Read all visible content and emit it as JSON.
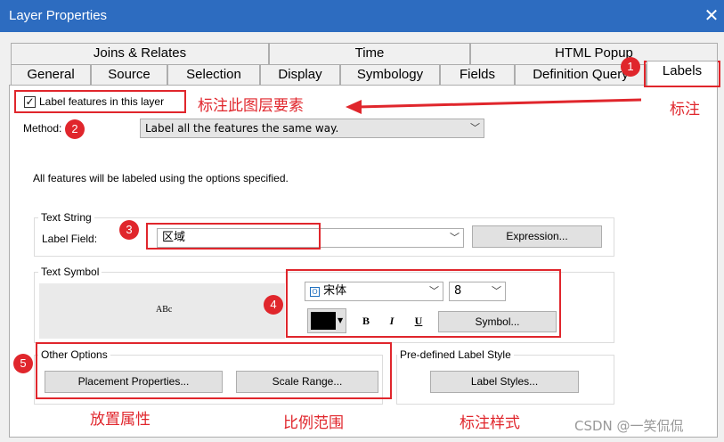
{
  "window": {
    "title": "Layer Properties"
  },
  "tabs_row1": [
    "Joins & Relates",
    "Time",
    "HTML Popup"
  ],
  "tabs_row2": [
    "General",
    "Source",
    "Selection",
    "Display",
    "Symbology",
    "Fields",
    "Definition Query",
    "Labels"
  ],
  "label_checkbox": {
    "label": "Label features in this layer",
    "checked": "✓"
  },
  "method": {
    "label": "Method:",
    "value": "Label all the features the same way."
  },
  "info_text": "All features will be labeled using the options specified.",
  "text_string": {
    "title": "Text String",
    "field_label": "Label Field:",
    "field_value": "区域",
    "expression_button": "Expression..."
  },
  "text_symbol": {
    "title": "Text Symbol",
    "preview": "ABc",
    "font": "宋体",
    "size": "8",
    "bold": "B",
    "italic": "I",
    "underline": "U",
    "symbol_button": "Symbol...",
    "color": "#000000"
  },
  "other_options": {
    "title": "Other Options",
    "placement_button": "Placement Properties...",
    "scale_button": "Scale Range..."
  },
  "predefined": {
    "title": "Pre-defined Label Style",
    "styles_button": "Label Styles..."
  },
  "annotations": {
    "badges": [
      "1",
      "2",
      "3",
      "4",
      "5"
    ],
    "label_this_layer": "标注此图层要素",
    "labels_tab": "标注",
    "placement": "放置属性",
    "scale": "比例范围",
    "style": "标注样式"
  },
  "watermark": "CSDN @一笑侃侃",
  "colors": {
    "titlebar": "#2d6cc0",
    "annotation_red": "#e0262c"
  }
}
